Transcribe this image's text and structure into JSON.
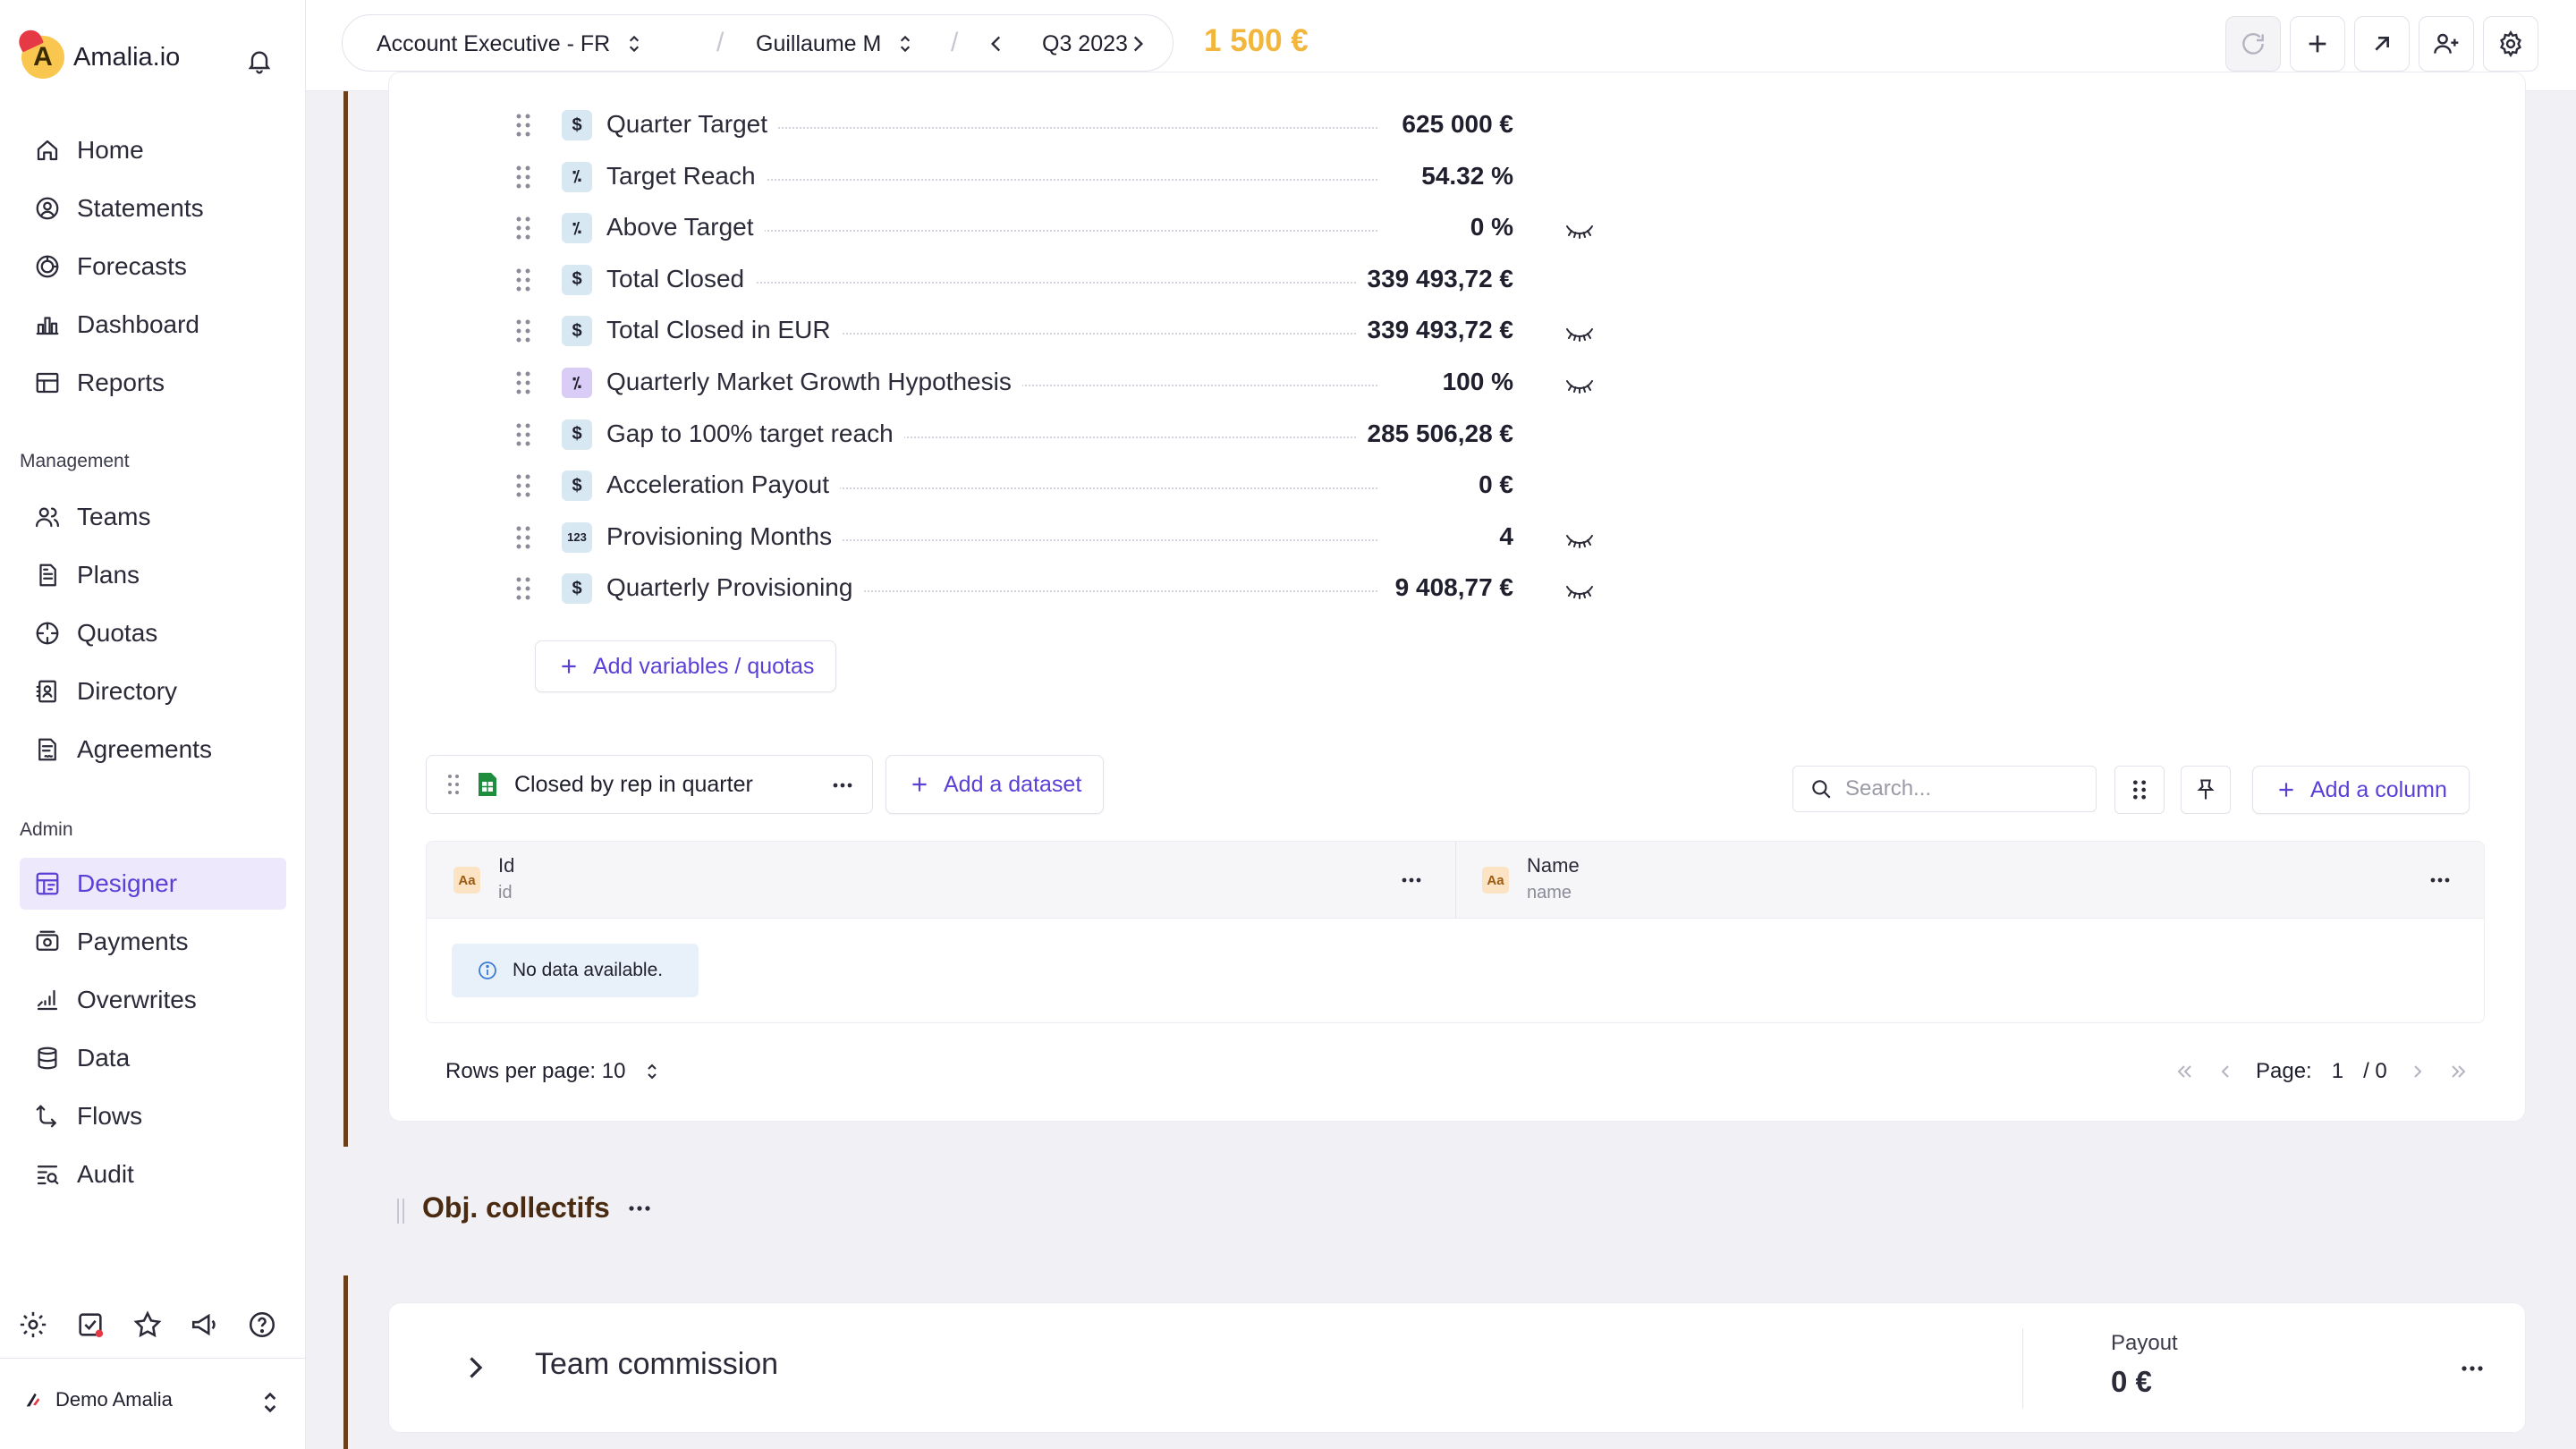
{
  "app": {
    "logo_text": "Amalia.io"
  },
  "sidebar": {
    "nav": [
      {
        "label": "Home",
        "icon": "home-icon"
      },
      {
        "label": "Statements",
        "icon": "statements-icon"
      },
      {
        "label": "Forecasts",
        "icon": "forecasts-icon"
      },
      {
        "label": "Dashboard",
        "icon": "dashboard-icon"
      },
      {
        "label": "Reports",
        "icon": "reports-icon"
      }
    ],
    "management_label": "Management",
    "management": [
      {
        "label": "Teams",
        "icon": "teams-icon"
      },
      {
        "label": "Plans",
        "icon": "plans-icon"
      },
      {
        "label": "Quotas",
        "icon": "quotas-icon"
      },
      {
        "label": "Directory",
        "icon": "directory-icon"
      },
      {
        "label": "Agreements",
        "icon": "agreements-icon"
      }
    ],
    "admin_label": "Admin",
    "admin": [
      {
        "label": "Designer",
        "icon": "designer-icon",
        "active": true
      },
      {
        "label": "Payments",
        "icon": "payments-icon"
      },
      {
        "label": "Overwrites",
        "icon": "overwrites-icon"
      },
      {
        "label": "Data",
        "icon": "data-icon"
      },
      {
        "label": "Flows",
        "icon": "flows-icon"
      },
      {
        "label": "Audit",
        "icon": "audit-icon"
      }
    ],
    "company": "Demo Amalia"
  },
  "topbar": {
    "plan": "Account Executive - FR",
    "user": "Guillaume M",
    "period": "Q3 2023",
    "total": "1 500 €"
  },
  "variables": [
    {
      "label": "Quarter Target",
      "value": "625 000 €",
      "type": "currency",
      "hidden": false
    },
    {
      "label": "Target Reach",
      "value": "54.32 %",
      "type": "percent",
      "hidden": false
    },
    {
      "label": "Above Target",
      "value": "0 %",
      "type": "percent",
      "hidden": true
    },
    {
      "label": "Total Closed",
      "value": "339 493,72 €",
      "type": "currency",
      "hidden": false
    },
    {
      "label": "Total Closed in EUR",
      "value": "339 493,72 €",
      "type": "currency",
      "hidden": true
    },
    {
      "label": "Quarterly Market Growth Hypothesis",
      "value": "100 %",
      "type": "percent-quota",
      "hidden": true
    },
    {
      "label": "Gap to 100% target reach",
      "value": "285 506,28 €",
      "type": "currency",
      "hidden": false
    },
    {
      "label": "Acceleration Payout",
      "value": "0 €",
      "type": "currency",
      "hidden": false
    },
    {
      "label": "Provisioning Months",
      "value": "4",
      "type": "number",
      "hidden": true
    },
    {
      "label": "Quarterly Provisioning",
      "value": "9 408,77 €",
      "type": "currency",
      "hidden": true
    }
  ],
  "add_variables_label": "Add variables / quotas",
  "dataset": {
    "name": "Closed by rep in quarter",
    "add_dataset_label": "Add a dataset",
    "search_placeholder": "Search...",
    "add_column_label": "Add a column",
    "columns": [
      {
        "title": "Id",
        "field": "id",
        "badge": "Aa"
      },
      {
        "title": "Name",
        "field": "name",
        "badge": "Aa"
      }
    ],
    "no_data": "No data available.",
    "rows_per_page": "Rows per page: 10",
    "page_label": "Page:",
    "page_current": "1",
    "page_total": "/ 0"
  },
  "section": {
    "title": "Obj. collectifs",
    "card_title": "Team commission",
    "payout_label": "Payout",
    "payout_value": "0 €"
  },
  "colors": {
    "accent": "#5b3fd6",
    "total": "#f2b63c",
    "timeline": "#6b3f1a"
  }
}
